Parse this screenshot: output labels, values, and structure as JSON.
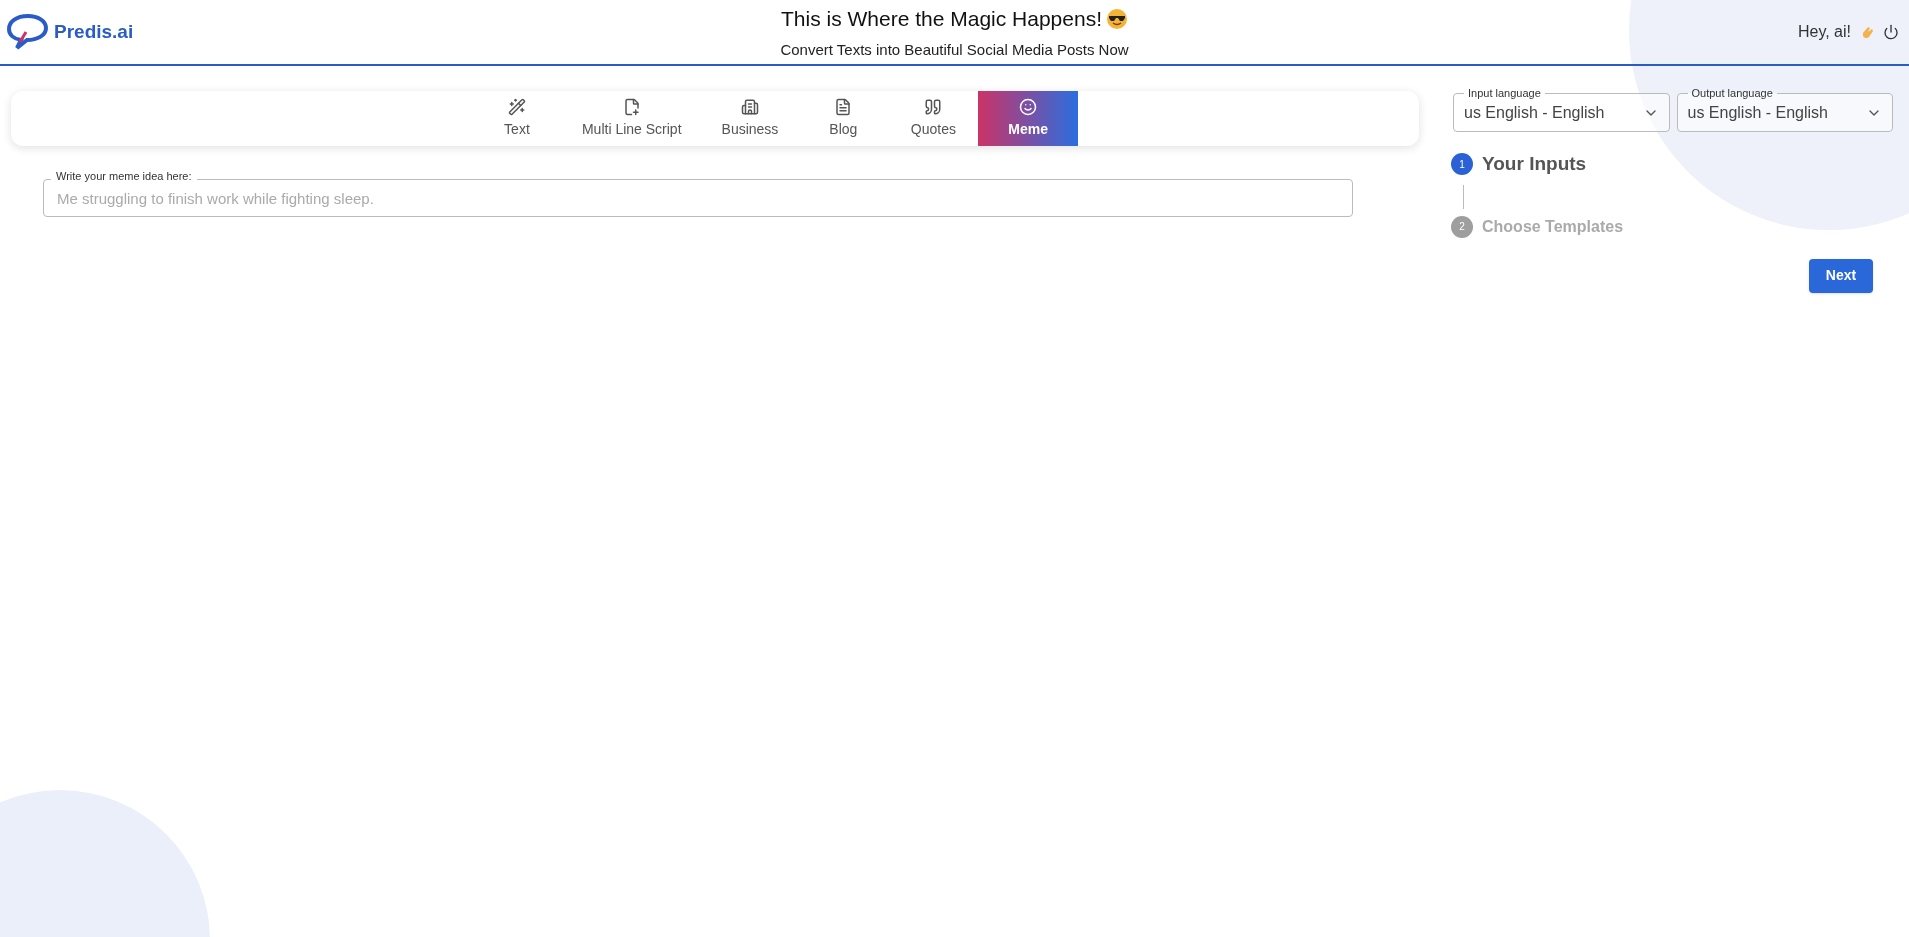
{
  "header": {
    "logo": "Predis.ai",
    "title": "This is Where the Magic Happens!",
    "subtitle": "Convert Texts into Beautiful Social Media Posts Now",
    "greeting": "Hey, ai!"
  },
  "tabs": [
    {
      "label": "Text",
      "selected": false
    },
    {
      "label": "Multi Line Script",
      "selected": false
    },
    {
      "label": "Business",
      "selected": false
    },
    {
      "label": "Blog",
      "selected": false
    },
    {
      "label": "Quotes",
      "selected": false
    },
    {
      "label": "Meme",
      "selected": true
    }
  ],
  "meme_field": {
    "label": "Write your meme idea here:",
    "placeholder": "Me struggling to finish work while fighting sleep."
  },
  "language_selects": [
    {
      "label": "Input language",
      "value": "us English - English"
    },
    {
      "label": "Output language",
      "value": "us English - English"
    }
  ],
  "steps": [
    {
      "number": "1",
      "label": "Your Inputs",
      "active": true
    },
    {
      "number": "2",
      "label": "Choose Templates",
      "active": false
    }
  ],
  "next_button": "Next"
}
